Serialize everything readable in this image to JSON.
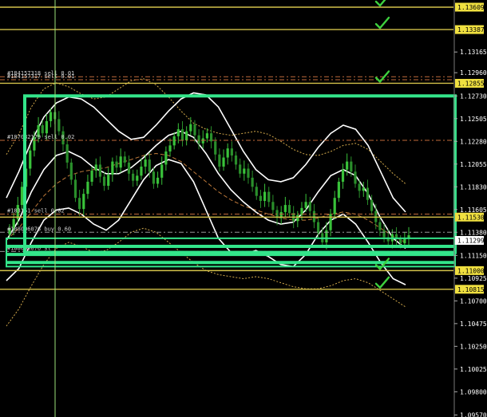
{
  "chart_data": {
    "type": "candlestick",
    "y_range": [
      1.0955,
      1.1368
    ],
    "price_axis": {
      "ticks": [
        "1.13165",
        "1.12960",
        "1.12730",
        "1.12505",
        "1.12280",
        "1.12055",
        "1.11830",
        "1.11605",
        "1.11380",
        "1.11150",
        "1.10925",
        "1.10700",
        "1.10475",
        "1.10250",
        "1.10025",
        "1.09800",
        "1.09570"
      ],
      "tick_values": [
        1.13165,
        1.1296,
        1.1273,
        1.12505,
        1.1228,
        1.12055,
        1.1183,
        1.11605,
        1.1138,
        1.1115,
        1.10925,
        1.107,
        1.10475,
        1.1025,
        1.10025,
        1.098,
        1.0957
      ]
    },
    "horizontal_levels": [
      {
        "price": 1.13609,
        "label": "1.13609",
        "color": "#d4c24a",
        "checked": true
      },
      {
        "price": 1.13387,
        "label": "1.13387",
        "color": "#d4c24a",
        "checked": true
      },
      {
        "price": 1.12855,
        "label": "1.12855",
        "color": "#d4c24a",
        "checked": true
      },
      {
        "price": 1.1153,
        "label": "1.11530",
        "color": "#d4c24a",
        "checked": false
      },
      {
        "price": 1.11,
        "label": "1.11000",
        "color": "#d4c24a",
        "checked": true
      },
      {
        "price": 1.10815,
        "label": "1.10815",
        "color": "#d4c24a",
        "checked": true
      }
    ],
    "current_price": {
      "price": 1.11299,
      "label": "1.11299"
    },
    "order_lines": [
      {
        "label": "#184157318 sell 0.01",
        "price": 1.1292,
        "color": "#c06a3a"
      },
      {
        "label": "#184157317 sell 0.01",
        "price": 1.1289,
        "color": "#c06a3a"
      },
      {
        "label": "#187082179 sell 0.02",
        "price": 1.1229,
        "color": "#c06a3a"
      },
      {
        "label": "#183151 sell 0.02",
        "price": 1.1156,
        "color": "#c06a3a"
      },
      {
        "label": "#188006076 buy 0.60",
        "price": 1.1138,
        "color": "#9a9a9a"
      },
      {
        "label": "#188006076 sl",
        "price": 1.1119,
        "color": "#9a9a9a"
      }
    ],
    "range_box": {
      "top": 1.1273,
      "bottom": 1.1118,
      "color": "#33e58a"
    },
    "zone_lines": [
      1.1124,
      1.1116,
      1.1108
    ],
    "candles_close": [
      1.1142,
      1.1151,
      1.1165,
      1.1183,
      1.1201,
      1.1219,
      1.1232,
      1.1244,
      1.1236,
      1.1248,
      1.1257,
      1.125,
      1.1238,
      1.1225,
      1.1207,
      1.119,
      1.1172,
      1.1161,
      1.1176,
      1.1188,
      1.1199,
      1.1205,
      1.1193,
      1.1184,
      1.1195,
      1.1208,
      1.1202,
      1.1213,
      1.1207,
      1.1196,
      1.1189,
      1.1194,
      1.1203,
      1.121,
      1.1198,
      1.1186,
      1.1192,
      1.1205,
      1.1218,
      1.1224,
      1.1233,
      1.124,
      1.1229,
      1.1238,
      1.1245,
      1.1234,
      1.1226,
      1.1231,
      1.1236,
      1.1228,
      1.1215,
      1.1203,
      1.1212,
      1.1221,
      1.1214,
      1.1205,
      1.1196,
      1.1201,
      1.1192,
      1.1183,
      1.1174,
      1.1169,
      1.1178,
      1.1168,
      1.116,
      1.1152,
      1.1158,
      1.1165,
      1.1157,
      1.1149,
      1.1155,
      1.1162,
      1.1168,
      1.1159,
      1.1148,
      1.1137,
      1.1128,
      1.114,
      1.1156,
      1.1172,
      1.1188,
      1.12,
      1.1208,
      1.1198,
      1.1186,
      1.1179,
      1.1182,
      1.117,
      1.1159,
      1.1148,
      1.114,
      1.1133,
      1.1129,
      1.1136,
      1.1131,
      1.1127,
      1.1132,
      1.1135
    ],
    "bollinger_upper": [
      1.1172,
      1.1198,
      1.1228,
      1.1252,
      1.1266,
      1.1272,
      1.127,
      1.1262,
      1.125,
      1.1238,
      1.123,
      1.1232,
      1.1244,
      1.1258,
      1.127,
      1.1276,
      1.1274,
      1.1262,
      1.124,
      1.1218,
      1.12,
      1.119,
      1.1188,
      1.1192,
      1.1205,
      1.1222,
      1.1236,
      1.1244,
      1.124,
      1.1224,
      1.1198,
      1.1172,
      1.1158
    ],
    "bollinger_middle": [
      1.113,
      1.115,
      1.1178,
      1.12,
      1.1214,
      1.1218,
      1.1212,
      1.1202,
      1.1196,
      1.1196,
      1.1202,
      1.1212,
      1.1224,
      1.1234,
      1.1238,
      1.1232,
      1.1216,
      1.1196,
      1.118,
      1.1168,
      1.1158,
      1.115,
      1.1146,
      1.1148,
      1.116,
      1.1178,
      1.1194,
      1.12,
      1.1194,
      1.1176,
      1.1152,
      1.1132,
      1.1122
    ],
    "bollinger_lower": [
      1.109,
      1.1102,
      1.1128,
      1.115,
      1.116,
      1.1162,
      1.1156,
      1.1146,
      1.114,
      1.115,
      1.117,
      1.119,
      1.1204,
      1.121,
      1.1206,
      1.1188,
      1.116,
      1.1132,
      1.1118,
      1.1116,
      1.112,
      1.1114,
      1.1106,
      1.1104,
      1.1116,
      1.1136,
      1.115,
      1.1156,
      1.1146,
      1.1128,
      1.1108,
      1.1092,
      1.1086
    ],
    "envelope_upper": [
      1.1215,
      1.1235,
      1.1262,
      1.128,
      1.1286,
      1.1282,
      1.1275,
      1.127,
      1.1272,
      1.128,
      1.1288,
      1.129,
      1.1284,
      1.1272,
      1.1258,
      1.1246,
      1.124,
      1.1236,
      1.1234,
      1.1236,
      1.1238,
      1.1235,
      1.1228,
      1.122,
      1.1215,
      1.1214,
      1.1218,
      1.1224,
      1.1226,
      1.122,
      1.1208,
      1.1196,
      1.1186
    ],
    "envelope_lower": [
      1.1045,
      1.1062,
      1.1085,
      1.1106,
      1.1122,
      1.1128,
      1.1124,
      1.1118,
      1.112,
      1.1128,
      1.1138,
      1.1142,
      1.1138,
      1.1128,
      1.1118,
      1.1108,
      1.11,
      1.1096,
      1.1094,
      1.1092,
      1.1094,
      1.1092,
      1.1088,
      1.1084,
      1.1082,
      1.1082,
      1.1085,
      1.109,
      1.1092,
      1.1088,
      1.108,
      1.1072,
      1.1064
    ],
    "moving_average": [
      1.113,
      1.1142,
      1.1158,
      1.1174,
      1.1186,
      1.1194,
      1.1198,
      1.12,
      1.1202,
      1.1206,
      1.121,
      1.1214,
      1.1216,
      1.1214,
      1.1208,
      1.1198,
      1.1188,
      1.1178,
      1.117,
      1.1164,
      1.116,
      1.1156,
      1.1152,
      1.115,
      1.115,
      1.1152,
      1.1156,
      1.1158,
      1.1156,
      1.115,
      1.1142,
      1.1134,
      1.1128
    ],
    "grid": false,
    "colors": {
      "background": "#000000",
      "candle_up": "#39c23a",
      "candle_down": "#2a8f2b",
      "level_line": "#d4c24a",
      "range_box": "#33e58a",
      "check_mark": "#3ed13e",
      "bands": "#ffffff",
      "envelope": "#d1a84a",
      "moving_average": "#c07a3a",
      "price_label_bg": "#f0e040",
      "current_price_bg": "#ffffff",
      "axis_text": "#ffffff",
      "crosshair": "#9be27a"
    }
  }
}
